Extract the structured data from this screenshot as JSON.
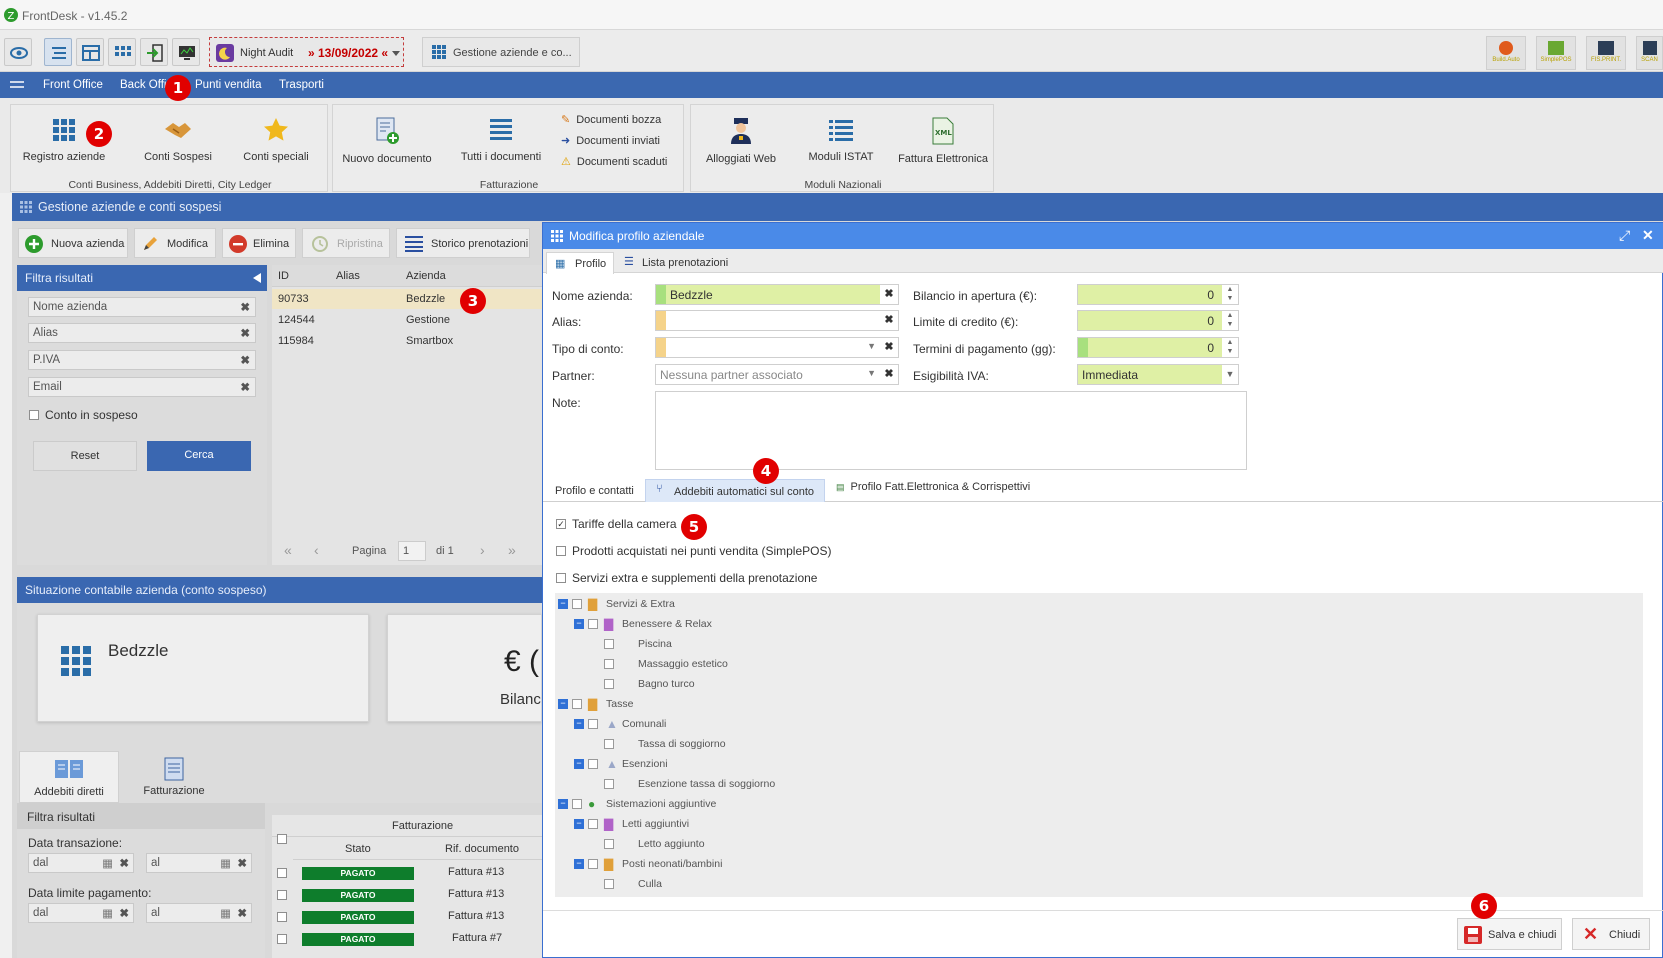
{
  "app": {
    "title": "FrontDesk - v1.45.2"
  },
  "toolbar": {
    "night_audit_label": "Night Audit",
    "night_audit_date": "» 13/09/2022 «",
    "gestione_tab": "Gestione aziende e co...",
    "right_icons": [
      "Build.Auto",
      "SimplePOS",
      "FIS.PRINT.",
      "SCAN"
    ]
  },
  "menu": {
    "items": [
      "Front Office",
      "Back Office",
      "Punti vendita",
      "Trasporti"
    ]
  },
  "ribbon": {
    "group1": {
      "buttons": [
        "Registro aziende",
        "Conti Sospesi",
        "Conti speciali"
      ],
      "label": "Conti Business, Addebiti Diretti, City Ledger"
    },
    "group2": {
      "buttons": [
        "Nuovo documento",
        "Tutti i documenti"
      ],
      "links": [
        "Documenti bozza",
        "Documenti inviati",
        "Documenti scaduti"
      ],
      "label": "Fatturazione"
    },
    "group3": {
      "buttons": [
        "Alloggiati Web",
        "Moduli ISTAT",
        "Fattura Elettronica"
      ],
      "label": "Moduli Nazionali"
    }
  },
  "win1": {
    "title": "Gestione aziende e conti sospesi",
    "buttons": [
      "Nuova azienda",
      "Modifica",
      "Elimina",
      "Ripristina",
      "Storico prenotazioni"
    ],
    "filter": {
      "title": "Filtra risultati",
      "fields": [
        "Nome azienda",
        "Alias",
        "P.IVA",
        "Email"
      ],
      "checkbox": "Conto in sospeso",
      "reset": "Reset",
      "search": "Cerca"
    },
    "grid": {
      "headers": [
        "ID",
        "Alias",
        "Azienda"
      ],
      "rows": [
        {
          "id": "90733",
          "alias": "",
          "azienda": "Bedzzle"
        },
        {
          "id": "124544",
          "alias": "",
          "azienda": "Gestione"
        },
        {
          "id": "115984",
          "alias": "",
          "azienda": "Smartbox"
        }
      ],
      "pager": {
        "label": "Pagina",
        "page": "1",
        "of": "di 1"
      }
    },
    "situation": {
      "title": "Situazione contabile azienda (conto sospeso)",
      "company": "Bedzzle",
      "currency_partial": "€ (",
      "balance_partial": "Bilanc"
    },
    "bottom_tabs": [
      "Addebiti diretti",
      "Fatturazione"
    ],
    "filter2": {
      "title": "Filtra risultati",
      "data_transazione": "Data transazione:",
      "data_limite": "Data limite pagamento:",
      "from": "dal",
      "to": "al"
    },
    "billing": {
      "header": "Fatturazione",
      "cols": [
        "Stato",
        "Rif. documento"
      ],
      "rows": [
        {
          "stato": "PAGATO",
          "rif": "Fattura #13"
        },
        {
          "stato": "PAGATO",
          "rif": "Fattura #13"
        },
        {
          "stato": "PAGATO",
          "rif": "Fattura #13"
        },
        {
          "stato": "PAGATO",
          "rif": "Fattura #7"
        }
      ]
    }
  },
  "modal": {
    "title": "Modifica profilo aziendale",
    "tabs": [
      "Profilo",
      "Lista prenotazioni"
    ],
    "fields": {
      "nome_label": "Nome azienda:",
      "nome_value": "Bedzzle",
      "alias_label": "Alias:",
      "tipo_label": "Tipo di conto:",
      "partner_label": "Partner:",
      "partner_placeholder": "Nessuna partner associato",
      "note_label": "Note:",
      "bilancio_label": "Bilancio in apertura (€):",
      "bilancio_value": "0",
      "limite_label": "Limite di credito (€):",
      "limite_value": "0",
      "termini_label": "Termini di pagamento (gg):",
      "termini_value": "0",
      "iva_label": "Esigibilità IVA:",
      "iva_value": "Immediata"
    },
    "subtabs": [
      "Profilo e contatti",
      "Addebiti automatici sul conto",
      "Profilo Fatt.Elettronica & Corrispettivi"
    ],
    "options": [
      {
        "label": "Tariffe della camera",
        "checked": true
      },
      {
        "label": "Prodotti acquistati nei punti vendita (SimplePOS)",
        "checked": false
      },
      {
        "label": "Servizi extra e supplementi della prenotazione",
        "checked": false
      }
    ],
    "tree": {
      "servizi": "Servizi & Extra",
      "benessere": "Benessere & Relax",
      "piscina": "Piscina",
      "massaggio": "Massaggio estetico",
      "bagno": "Bagno turco",
      "tasse": "Tasse",
      "comunali": "Comunali",
      "tassa_soggiorno": "Tassa di soggiorno",
      "esenzioni": "Esenzioni",
      "esenzione": "Esenzione tassa di soggiorno",
      "sistemazioni": "Sistemazioni aggiuntive",
      "letti": "Letti aggiuntivi",
      "letto": "Letto aggiunto",
      "posti": "Posti neonati/bambini",
      "culla": "Culla"
    },
    "save": "Salva e chiudi",
    "close": "Chiudi"
  },
  "badges": [
    "1",
    "2",
    "3",
    "4",
    "5",
    "6"
  ],
  "colors": {
    "blue": "#3a67b1",
    "modal_blue": "#4a8ae8",
    "green_field": "#dff0a5",
    "paid": "#0e7d2c",
    "badge": "#e10000"
  }
}
